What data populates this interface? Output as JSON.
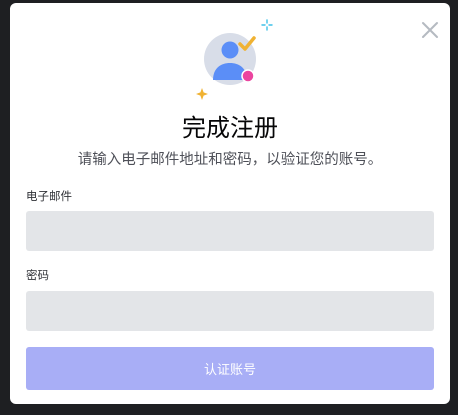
{
  "dialog": {
    "title": "完成注册",
    "subtitle": "请输入电子邮件地址和密码，以验证您的账号。",
    "email": {
      "label": "电子邮件",
      "value": "",
      "placeholder": ""
    },
    "password": {
      "label": "密码",
      "value": "",
      "placeholder": ""
    },
    "submit_label": "认证账号",
    "close_icon": "close-icon",
    "illustration_icon": "verified-user-icon"
  },
  "colors": {
    "backdrop": "#1e1f22",
    "modal": "#ffffff",
    "input_bg": "#e3e5e8",
    "button_disabled": "#a8aef6",
    "avatar_blue": "#5b8ef7",
    "check_gold": "#f0b232",
    "dot_pink": "#eb459f",
    "sparkle_cyan": "#3fc1e8"
  }
}
